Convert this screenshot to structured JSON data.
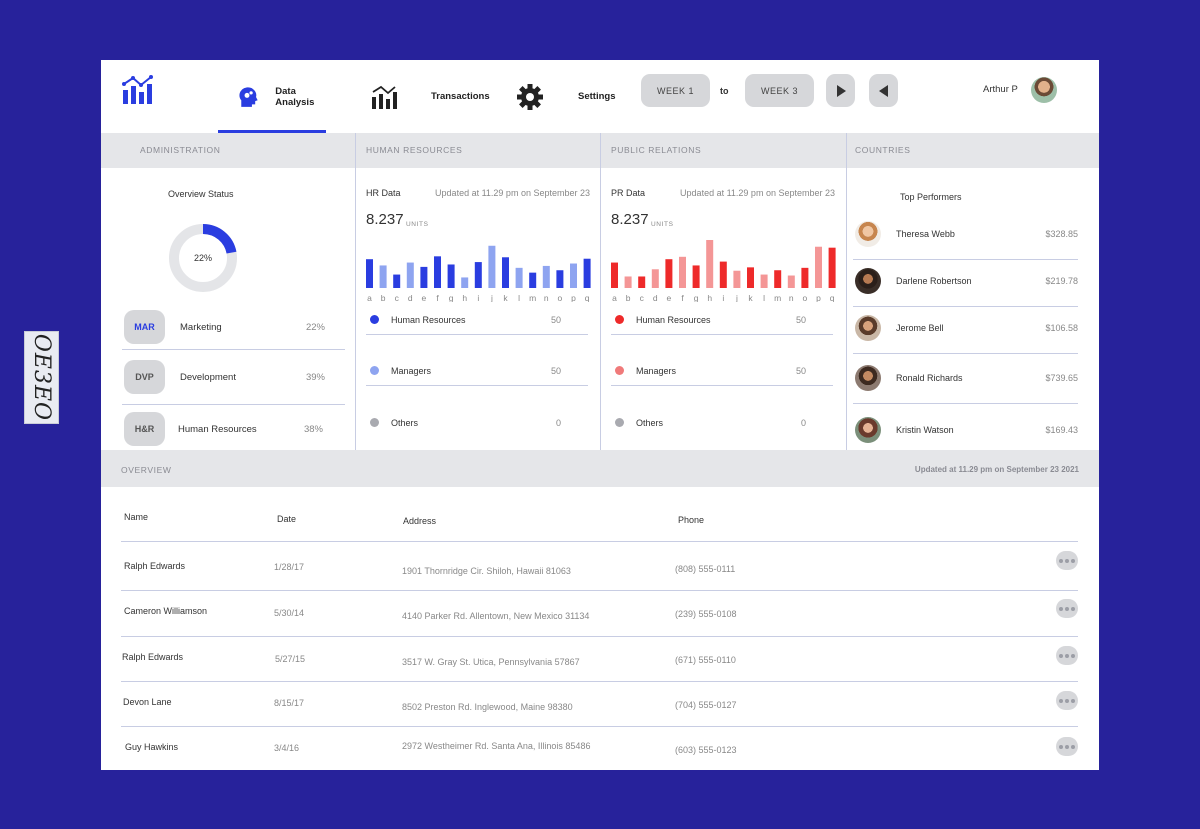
{
  "watermark": "OE3EO",
  "colors": {
    "page_bg": "#27229b",
    "accent": "#2a3de0",
    "hr_dark": "#2a3de0",
    "hr_light": "#8ea4f0",
    "pr_dark": "#ee2a2a",
    "pr_light": "#f49696"
  },
  "nav": {
    "items": [
      {
        "label": "Data Analysis",
        "icon": "head-gears-icon",
        "active": true
      },
      {
        "label": "Transactions",
        "icon": "bar-chart-icon"
      },
      {
        "label": "Settings",
        "icon": "gear-icon"
      }
    ],
    "week_from": "WEEK 1",
    "to_label": "to",
    "week_to": "WEEK 3",
    "user": "Arthur P"
  },
  "sections": {
    "administration": "ADMINISTRATION",
    "human_resources": "HUMAN RESOURCES",
    "public_relations": "PUBLIC RELATIONS",
    "countries": "COUNTRIES"
  },
  "admin": {
    "title": "Overview Status",
    "donut_percent": 22,
    "donut_label": "22%",
    "rows": [
      {
        "badge": "MAR",
        "label": "Marketing",
        "pct": "22%"
      },
      {
        "badge": "DVP",
        "label": "Development",
        "pct": "39%"
      },
      {
        "badge": "H&R",
        "label": "Human Resources",
        "pct": "38%"
      }
    ]
  },
  "chart_data": [
    {
      "type": "bar",
      "title": "HR Data",
      "categories": [
        "a",
        "b",
        "c",
        "d",
        "e",
        "f",
        "g",
        "h",
        "i",
        "j",
        "k",
        "l",
        "m",
        "n",
        "o",
        "p",
        "q"
      ],
      "values": [
        60,
        47,
        28,
        53,
        44,
        66,
        49,
        22,
        54,
        88,
        64,
        42,
        32,
        46,
        37,
        51,
        61
      ],
      "colors": [
        "dark",
        "light",
        "dark",
        "light",
        "dark",
        "dark",
        "dark",
        "light",
        "dark",
        "light",
        "dark",
        "light",
        "dark",
        "light",
        "dark",
        "light",
        "dark"
      ],
      "ylim": [
        0,
        100
      ]
    },
    {
      "type": "bar",
      "title": "PR Data",
      "categories": [
        "a",
        "b",
        "c",
        "d",
        "e",
        "f",
        "g",
        "h",
        "i",
        "j",
        "k",
        "l",
        "m",
        "n",
        "o",
        "p",
        "q"
      ],
      "values": [
        53,
        24,
        24,
        39,
        60,
        65,
        47,
        100,
        55,
        36,
        43,
        28,
        37,
        26,
        42,
        86,
        84
      ],
      "colors": [
        "dark",
        "light",
        "dark",
        "light",
        "dark",
        "light",
        "dark",
        "light",
        "dark",
        "light",
        "dark",
        "light",
        "dark",
        "light",
        "dark",
        "light",
        "dark"
      ],
      "ylim": [
        0,
        100
      ]
    }
  ],
  "hr": {
    "title": "HR Data",
    "updated": "Updated at 11.29 pm on September 23",
    "value": "8.237",
    "unit": "UNITS",
    "legend": [
      {
        "name": "Human Resources",
        "value": "50",
        "color": "#2a3de0"
      },
      {
        "name": "Managers",
        "value": "50",
        "color": "#8ea4f0"
      },
      {
        "name": "Others",
        "value": "0",
        "color": "#a9aab0"
      }
    ]
  },
  "pr": {
    "title": "PR Data",
    "updated": "Updated at 11.29 pm on September 23",
    "value": "8.237",
    "unit": "UNITS",
    "legend": [
      {
        "name": "Human Resources",
        "value": "50",
        "color": "#ee2a2a"
      },
      {
        "name": "Managers",
        "value": "50",
        "color": "#f07a7a"
      },
      {
        "name": "Others",
        "value": "0",
        "color": "#a9aab0"
      }
    ]
  },
  "top_performers": {
    "title": "Top Performers",
    "people": [
      {
        "name": "Theresa Webb",
        "amount": "$328.85"
      },
      {
        "name": "Darlene Robertson",
        "amount": "$219.78"
      },
      {
        "name": "Jerome Bell",
        "amount": "$106.58"
      },
      {
        "name": "Ronald Richards",
        "amount": "$739.65"
      },
      {
        "name": "Kristin Watson",
        "amount": "$169.43"
      }
    ]
  },
  "overview": {
    "label": "OVERVIEW",
    "updated": "Updated at 11.29 pm on September 23 2021",
    "columns": [
      "Name",
      "Date",
      "Address",
      "Phone"
    ],
    "rows": [
      {
        "name": "Ralph Edwards",
        "date": "1/28/17",
        "address": "1901 Thornridge Cir. Shiloh, Hawaii 81063",
        "phone": "(808) 555-0111"
      },
      {
        "name": "Cameron Williamson",
        "date": "5/30/14",
        "address": "4140 Parker Rd. Allentown, New Mexico 31134",
        "phone": "(239) 555-0108"
      },
      {
        "name": "Ralph Edwards",
        "date": "5/27/15",
        "address": "3517 W. Gray St. Utica, Pennsylvania 57867",
        "phone": "(671) 555-0110"
      },
      {
        "name": "Devon Lane",
        "date": "8/15/17",
        "address": "8502 Preston Rd. Inglewood, Maine 98380",
        "phone": "(704) 555-0127"
      },
      {
        "name": "Guy Hawkins",
        "date": "3/4/16",
        "address": "2972 Westheimer Rd. Santa Ana, Illinois 85486",
        "phone": "(603) 555-0123"
      }
    ]
  }
}
